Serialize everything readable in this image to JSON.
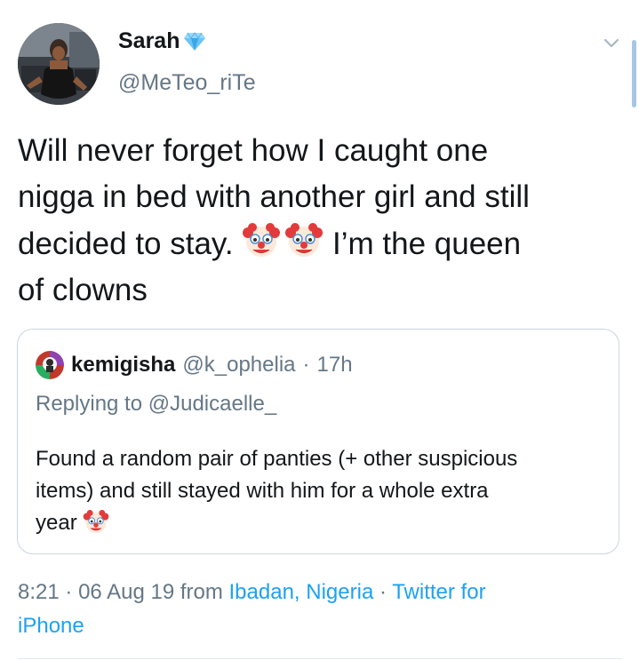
{
  "tweet": {
    "author": {
      "display_name": "Sarah",
      "verified_badge_icon": "blue-diamond-icon",
      "handle": "@MeTeo_riTe",
      "avatar_icon": "profile-photo"
    },
    "text_line1": "Will never forget how I caught one",
    "text_line2": "nigga in bed with another girl and still",
    "text_line3_before": "decided to stay. ",
    "text_line3_after": " I’m the queen",
    "text_line4": "of clowns",
    "emoji_icon": "clown-face-icon",
    "menu_icon": "chevron-down-icon"
  },
  "quoted_tweet": {
    "display_name": "kemigisha",
    "handle": "@k_ophelia",
    "separator": "·",
    "time": "17h",
    "replying_prefix": "Replying to",
    "replying_to": "@Judicaelle_",
    "text_line1": "Found a random pair of panties (+ other suspicious",
    "text_line2": "items) and still stayed with him for a whole extra",
    "text_line3": "year "
  },
  "meta": {
    "time": "8:21",
    "separator": "·",
    "date": "06 Aug 19",
    "from": "from",
    "location": "Ibadan, Nigeria",
    "source_line1": "Twitter for",
    "source_line2": "iPhone"
  },
  "colors": {
    "text": "#14171a",
    "secondary": "#657786",
    "link": "#1da1f2",
    "border": "#ccd6dd"
  }
}
